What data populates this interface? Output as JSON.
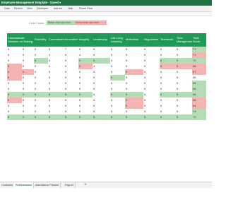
{
  "title": "Employee Management template",
  "title_suffix": "Saved",
  "ribbon_tabs": [
    "Data",
    "Review",
    "View",
    "Developer",
    "Add-ins",
    "Help",
    "Power Pivot"
  ],
  "legend": {
    "label": "Color Codes",
    "better": "Better than last time",
    "worse": "Worse than last time"
  },
  "table": {
    "headers": [
      "Communicati Decision-on Making",
      "Flexibility",
      "Commitment",
      "Innovation",
      "Integrity",
      "Leadership",
      "Life-Long Learning",
      "Motivation",
      "Negotiation",
      "Teamwork",
      "Time Management",
      "Total Score"
    ],
    "rows": [
      {
        "values": [
          "5",
          "5",
          "5",
          "5",
          "7",
          "5",
          "5",
          "5",
          "5",
          "5",
          "5",
          "5",
          "71"
        ],
        "styles": [
          "",
          "",
          "",
          "",
          "",
          "",
          "",
          "",
          "",
          "",
          "",
          "",
          "g"
        ]
      },
      {
        "values": [
          "5",
          "5",
          "5",
          "4",
          "5",
          "4",
          "5",
          "5",
          "5",
          "5",
          "5",
          "5",
          "71"
        ],
        "styles": [
          "",
          "",
          "",
          "",
          "",
          "",
          "",
          "",
          "",
          "",
          "",
          "",
          "r"
        ]
      },
      {
        "values": [
          "5",
          "5",
          "5",
          "5",
          "5",
          "5",
          "5",
          "5",
          "5",
          "5",
          "5",
          "5",
          "72"
        ],
        "styles": [
          "",
          "",
          "g",
          "",
          "",
          "g",
          "g",
          "",
          "",
          "",
          "g",
          "g",
          "g"
        ]
      },
      {
        "values": [
          "5",
          "5",
          "5",
          "4",
          "5",
          "5",
          "4",
          "5",
          "5",
          "5",
          "5",
          "5",
          "58"
        ],
        "styles": [
          "r",
          "",
          "",
          "",
          "",
          "r",
          "",
          "",
          "",
          "",
          "r",
          "r",
          "r"
        ]
      },
      {
        "values": [
          "4",
          "5",
          "5",
          "5",
          "5",
          "5",
          "5",
          "5",
          "5",
          "5",
          "5",
          "5",
          "57"
        ],
        "styles": [
          "r",
          "r",
          "",
          "",
          "",
          "",
          "",
          "",
          "r",
          "",
          "",
          "",
          "r"
        ]
      },
      {
        "values": [
          "5",
          "5",
          "5",
          "5",
          "5",
          "5",
          "5",
          "5",
          "5",
          "5",
          "5",
          "5",
          "58"
        ],
        "styles": [
          "r",
          "",
          "",
          "",
          "",
          "",
          "",
          "g",
          "",
          "",
          "",
          "",
          ""
        ]
      },
      {
        "values": [
          "5",
          "5",
          "5",
          "5",
          "5",
          "5",
          "5",
          "5",
          "5",
          "5",
          "5",
          "5",
          "64"
        ],
        "styles": [
          "",
          "",
          "",
          "",
          "",
          "",
          "",
          "",
          "",
          "",
          "",
          "",
          "g"
        ]
      },
      {
        "values": [
          "5",
          "5",
          "5",
          "5",
          "5",
          "5",
          "5",
          "5",
          "5",
          "5",
          "5",
          "5",
          "68"
        ],
        "styles": [
          "",
          "",
          "",
          "",
          "",
          "",
          "",
          "",
          "",
          "",
          "",
          "",
          "g"
        ]
      },
      {
        "values": [
          "5",
          "5",
          "5",
          "5",
          "5",
          "5",
          "5",
          "5",
          "5",
          "5",
          "5",
          "5",
          "68"
        ],
        "styles": [
          "g",
          "g",
          "g",
          "g",
          "g",
          "g",
          "",
          "g",
          "g",
          "",
          "g",
          "g",
          "g"
        ]
      },
      {
        "values": [
          "5",
          "5",
          "5",
          "5",
          "5",
          "5",
          "5",
          "5",
          "5",
          "5",
          "5",
          "5",
          "58"
        ],
        "styles": [
          "r",
          "",
          "",
          "",
          "",
          "",
          "",
          "",
          "r",
          "",
          "",
          "",
          "r"
        ]
      },
      {
        "values": [
          "5",
          "5",
          "5",
          "5",
          "5",
          "5",
          "5",
          "5",
          "5",
          "5",
          "5",
          "5",
          "54"
        ],
        "styles": [
          "",
          "",
          "",
          "",
          "",
          "",
          "",
          "",
          "r",
          "",
          "",
          "",
          "r"
        ]
      },
      {
        "values": [
          "5",
          "5",
          "5",
          "5",
          "5",
          "5",
          "5",
          "5",
          "5",
          "5",
          "5",
          "5",
          "74"
        ],
        "styles": [
          "",
          "",
          "",
          "",
          "",
          "",
          "",
          "",
          "",
          "",
          "",
          "",
          "g"
        ]
      },
      {
        "values": [
          "5",
          "5",
          "5",
          "5",
          "5",
          "5",
          "5",
          "5",
          "5",
          "5",
          "5",
          "5",
          "72"
        ],
        "styles": [
          "g",
          "g",
          "g",
          "g",
          "g",
          "g",
          "g",
          "g",
          "g",
          "g",
          "g",
          "g",
          "g"
        ]
      }
    ]
  },
  "sheet_tabs": [
    "Contracts",
    "Performance",
    "Attendance Planner",
    "Payroll"
  ],
  "active_tab": "Performance",
  "add_sheet": "+"
}
